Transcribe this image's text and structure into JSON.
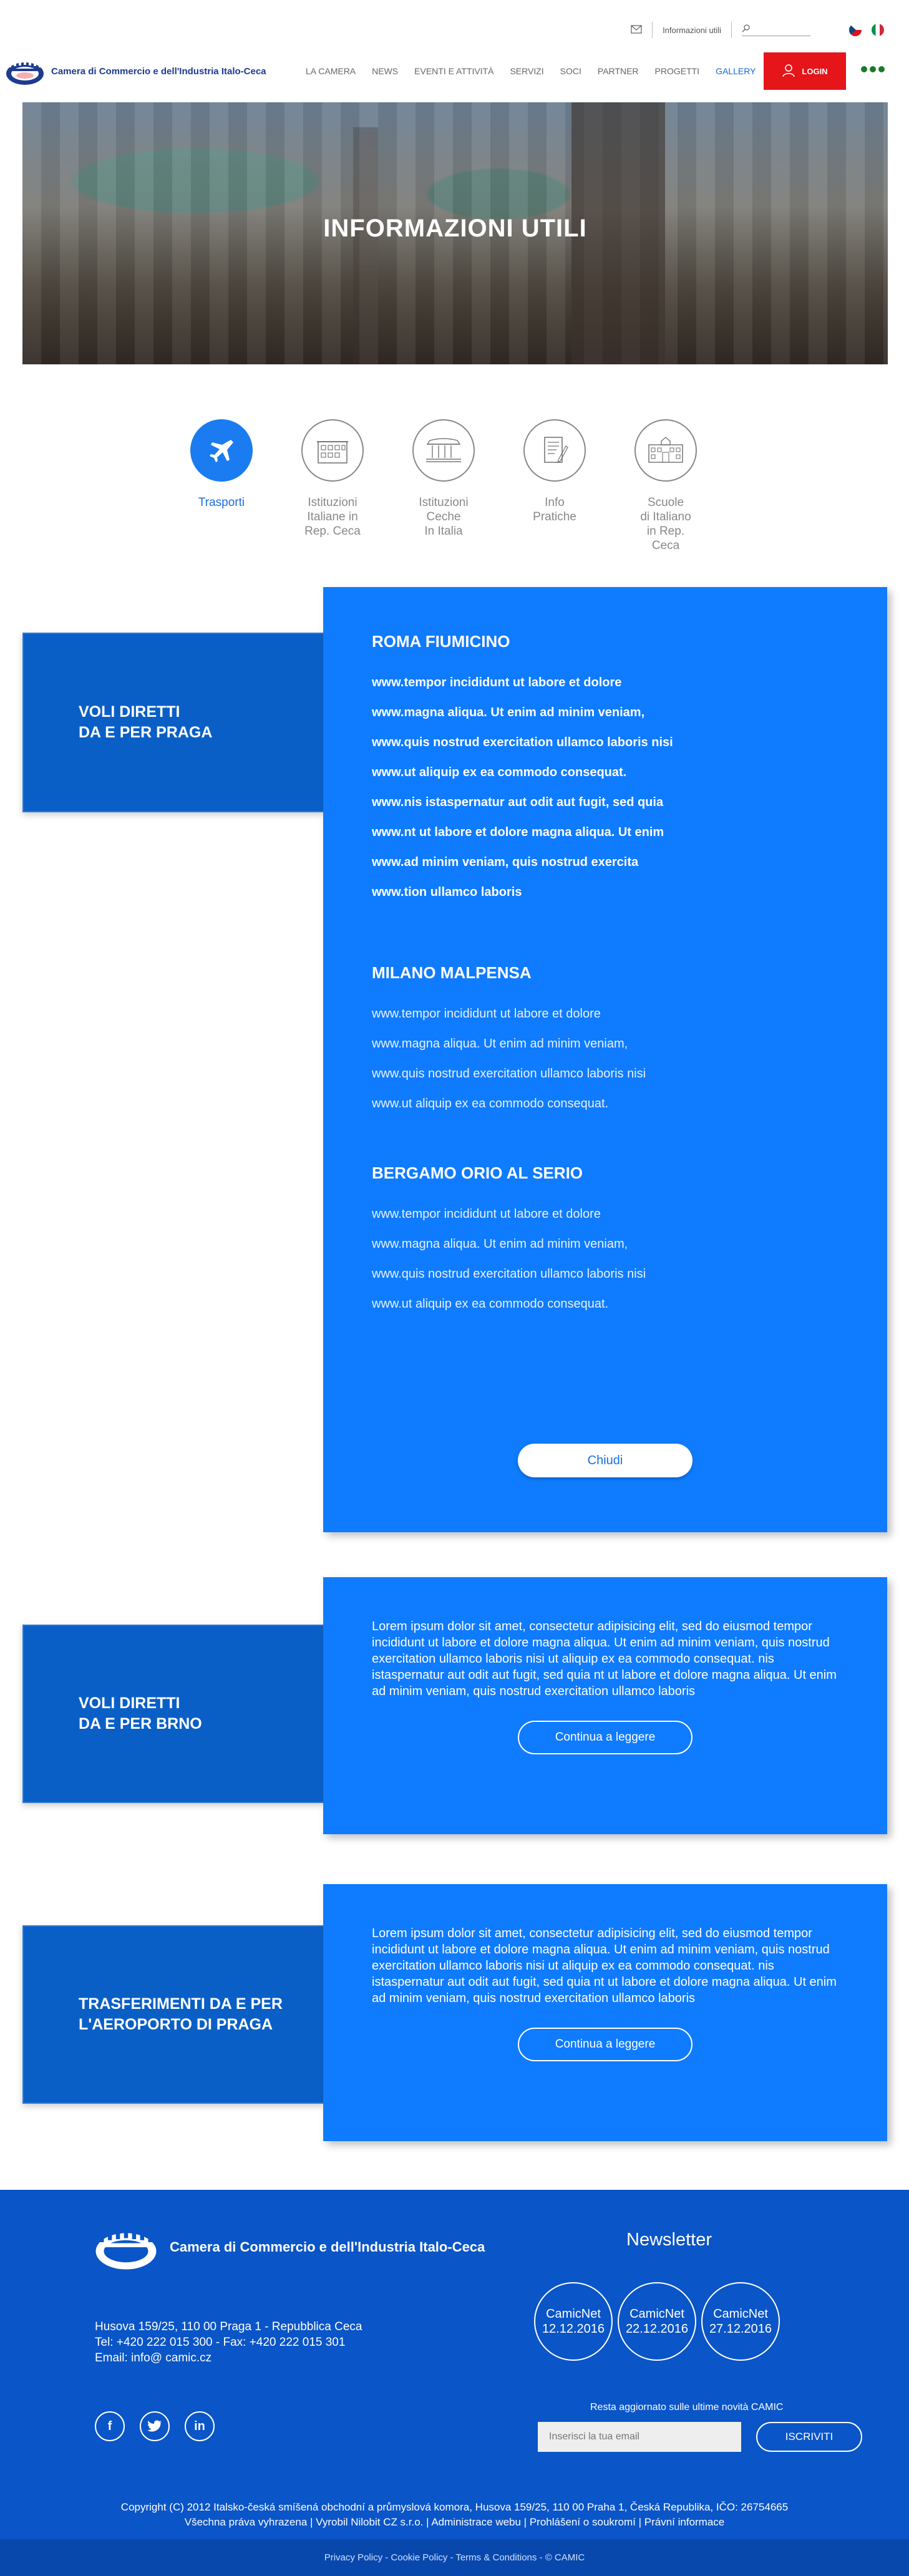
{
  "topbar": {
    "info_link": "Informazioni utili",
    "search_placeholder": ""
  },
  "header": {
    "brand": "Camera di Commercio e dell'Industria Italo-Ceca",
    "nav": [
      "LA CAMERA",
      "NEWS",
      "EVENTI E ATTIVITÀ",
      "SERVIZI",
      "SOCI",
      "PARTNER",
      "PROGETTI",
      "GALLERY"
    ],
    "login": "LOGIN"
  },
  "hero": {
    "title": "INFORMAZIONI UTILI"
  },
  "categories": [
    {
      "label_lines": [
        "Trasporti"
      ],
      "icon": "airplane-icon"
    },
    {
      "label_lines": [
        "Istituzioni",
        "Italiane in",
        "Rep. Ceca"
      ],
      "icon": "building-icon"
    },
    {
      "label_lines": [
        "Istituzioni",
        "Ceche",
        "In Italia"
      ],
      "icon": "columns-icon"
    },
    {
      "label_lines": [
        "Info",
        "Pratiche"
      ],
      "icon": "document-icon"
    },
    {
      "label_lines": [
        "Scuole",
        "di Italiano",
        "in Rep. Ceca"
      ],
      "icon": "school-icon"
    }
  ],
  "section1": {
    "label_lines": [
      "VOLI DIRETTI",
      "DA E PER PRAGA"
    ],
    "groups": [
      {
        "title": "ROMA FIUMICINO",
        "links": [
          "www.tempor incididunt ut labore et dolore",
          "www.magna aliqua. Ut enim ad minim veniam,",
          "www.quis nostrud exercitation ullamco laboris nisi",
          "www.ut aliquip ex ea commodo consequat.",
          "www.nis istaspernatur aut odit aut fugit, sed quia",
          "www.nt ut labore et dolore magna aliqua. Ut enim",
          "www.ad minim veniam, quis nostrud exercita",
          "www.tion ullamco laboris"
        ]
      },
      {
        "title": "MILANO MALPENSA",
        "links": [
          "www.tempor incididunt ut labore et dolore",
          "www.magna aliqua. Ut enim ad minim veniam,",
          "www.quis nostrud exercitation ullamco laboris nisi",
          "www.ut aliquip ex ea commodo consequat."
        ]
      },
      {
        "title": "BERGAMO ORIO AL SERIO",
        "links": [
          "www.tempor incididunt ut labore et dolore",
          "www.magna aliqua. Ut enim ad minim veniam,",
          "www.quis nostrud exercitation ullamco laboris nisi",
          "www.ut aliquip ex ea commodo consequat."
        ]
      }
    ],
    "close_button": "Chiudi"
  },
  "section2": {
    "label_lines": [
      "VOLI DIRETTI",
      "DA E PER BRNO"
    ],
    "text": "Lorem ipsum dolor sit amet, consectetur adipisicing elit, sed do eiusmod tempor incididunt ut labore et dolore magna aliqua. Ut enim ad minim veniam, quis nostrud exercitation ullamco laboris nisi ut aliquip ex ea commodo consequat. nis istaspernatur aut odit aut fugit, sed quia nt ut labore et dolore magna aliqua. Ut enim ad minim veniam, quis nostrud exercitation ullamco laboris",
    "button": "Continua a leggere"
  },
  "section3": {
    "label_lines": [
      "TRASFERIMENTI DA E PER",
      "L'AEROPORTO DI PRAGA"
    ],
    "text": "Lorem ipsum dolor sit amet, consectetur adipisicing elit, sed do eiusmod tempor incididunt ut labore et dolore magna aliqua. Ut enim ad minim veniam, quis nostrud exercitation ullamco laboris nisi ut aliquip ex ea commodo consequat. nis istaspernatur aut odit aut fugit, sed quia nt ut labore et dolore magna aliqua. Ut enim ad minim veniam, quis nostrud exercitation ullamco laboris",
    "button": "Continua a leggere"
  },
  "footer": {
    "brand": "Camera di Commercio e dell'Industria Italo-Ceca",
    "address_lines": [
      "Husova 159/25, 110 00 Praga 1 - Repubblica Ceca",
      "Tel: +420 222 015 300 - Fax: +420 222 015 301",
      "Email: info@ camic.cz"
    ],
    "social": [
      "f",
      "t",
      "in"
    ],
    "newsletter_title": "Newsletter",
    "newsletter_items": [
      {
        "name": "CamicNet",
        "date": "12.12.2016"
      },
      {
        "name": "CamicNet",
        "date": "22.12.2016"
      },
      {
        "name": "CamicNet",
        "date": "27.12.2016"
      }
    ],
    "newsletter_sub": "Resta aggiornato sulle ultime novità CAMIC",
    "email_placeholder": "Inserisci la tua email",
    "subscribe": "ISCRIVITI",
    "copyright_lines": [
      "Copyright (C) 2012 Italsko-česká smíšená obchodní a průmyslová komora, Husova 159/25, 110 00 Praha 1, Česká Republika, IČO: 26754665",
      "Všechna práva vyhrazena | Vyrobil Nilobit CZ s.r.o. | Administrace webu | Prohlášení o soukromí | Právní informace"
    ],
    "bottom_links": "Privacy Policy - Cookie Policy - Terms & Conditions - © CAMIC"
  },
  "colors": {
    "primary": "#0f7bff",
    "dark_blue": "#0a55c7",
    "login_red": "#e5151a"
  }
}
